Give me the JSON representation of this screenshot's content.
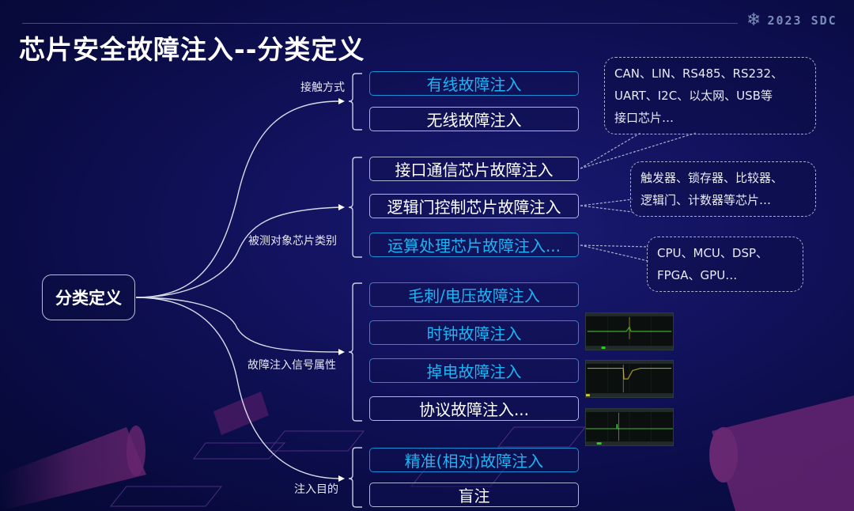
{
  "header": {
    "title": "芯片安全故障注入--分类定义",
    "logo_icon": "snowflake-icon",
    "logo_text": "2023 SDC"
  },
  "root": {
    "label": "分类定义"
  },
  "categories": [
    {
      "label": "接触方式",
      "items": [
        {
          "label": "有线故障注入",
          "style": "blue"
        },
        {
          "label": "无线故障注入",
          "style": "white"
        }
      ]
    },
    {
      "label": "被测对象芯片类别",
      "items": [
        {
          "label": "接口通信芯片故障注入",
          "style": "white"
        },
        {
          "label": "逻辑门控制芯片故障注入",
          "style": "white"
        },
        {
          "label": "运算处理芯片故障注入...",
          "style": "blue"
        }
      ]
    },
    {
      "label": "故障注入信号属性",
      "items": [
        {
          "label": "毛刺/电压故障注入",
          "style": "blue"
        },
        {
          "label": "时钟故障注入",
          "style": "blue"
        },
        {
          "label": "掉电故障注入",
          "style": "blue"
        },
        {
          "label": "协议故障注入...",
          "style": "white"
        }
      ]
    },
    {
      "label": "注入目的",
      "items": [
        {
          "label": "精准(相对)故障注入",
          "style": "blue"
        },
        {
          "label": "盲注",
          "style": "white"
        }
      ]
    }
  ],
  "callouts": [
    {
      "lines": [
        "CAN、LIN、RS485、RS232、",
        "UART、I2C、以太网、USB等",
        "接口芯片…"
      ]
    },
    {
      "lines": [
        "触发器、锁存器、比较器、",
        "逻辑门、计数器等芯片…"
      ]
    },
    {
      "lines": [
        "CPU、MCU、DSP、",
        "FPGA、GPU…"
      ]
    }
  ],
  "waveforms": [
    {
      "name": "clock-glitch-waveform"
    },
    {
      "name": "power-down-waveform"
    },
    {
      "name": "protocol-waveform"
    }
  ],
  "colors": {
    "accent_blue": "#1cb4f2",
    "border_blue": "#1a8fd6",
    "border_white": "#aeb4d4"
  }
}
